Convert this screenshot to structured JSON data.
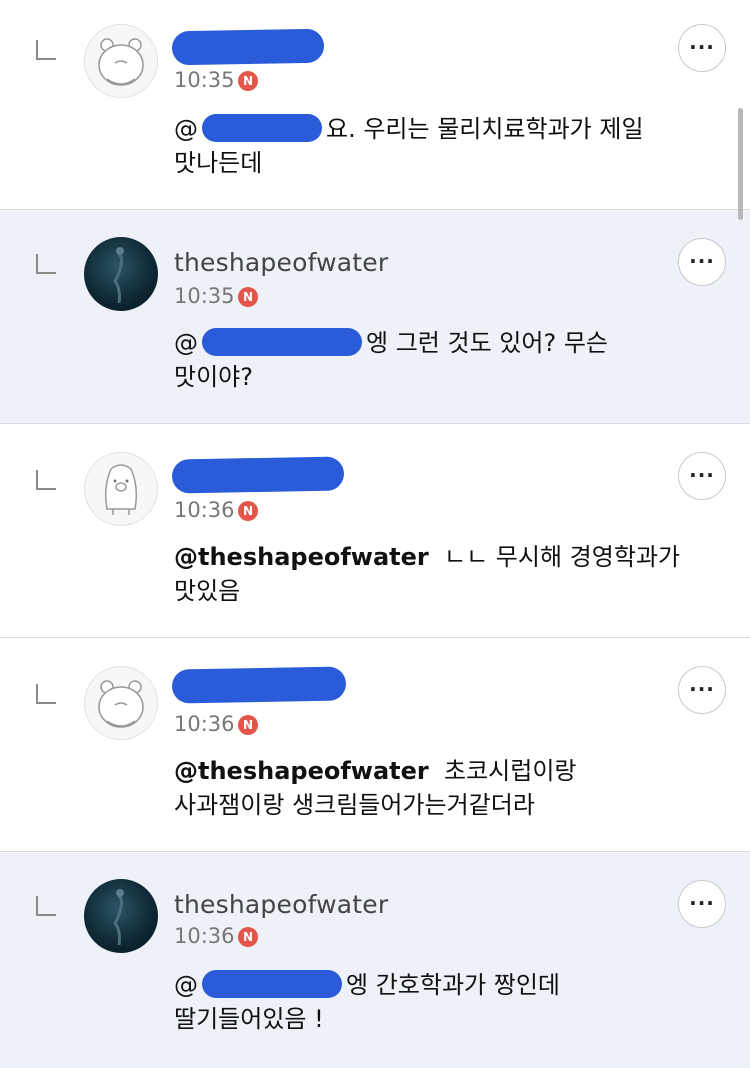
{
  "comments": [
    {
      "nickname": "",
      "nickname_redacted": true,
      "time": "10:35",
      "badge": "N",
      "avatar": "bear-character-icon",
      "text_prefix": "@",
      "text_after_redaction": "요. 우리는 물리치료학과가 제일 맛나든데",
      "mention": "",
      "more_label": "···"
    },
    {
      "nickname": "theshapeofwater",
      "nickname_redacted": false,
      "time": "10:35",
      "badge": "N",
      "avatar": "underwater-photo",
      "text_prefix": "@",
      "text_after_redaction": "엥 그런 것도 있어? 무슨 맛이야?",
      "mention": "",
      "more_label": "···"
    },
    {
      "nickname": "",
      "nickname_redacted": true,
      "time": "10:36",
      "badge": "N",
      "avatar": "penguin-character-icon",
      "mention": "@theshapeofwater",
      "text": "ㄴㄴ 무시해 경영학과가 맛있음",
      "more_label": "···"
    },
    {
      "nickname": "",
      "nickname_redacted": true,
      "time": "10:36",
      "badge": "N",
      "avatar": "bear-character-icon",
      "mention": "@theshapeofwater",
      "text": "초코시럽이랑 사과잼이랑 생크림들어가는거같더라",
      "more_label": "···"
    },
    {
      "nickname": "theshapeofwater",
      "nickname_redacted": false,
      "time": "10:36",
      "badge": "N",
      "avatar": "underwater-photo",
      "text_prefix": "@",
      "text_after_redaction": "엥 간호학과가 짱인데 딸기들어있음 !",
      "mention": "",
      "more_label": "···"
    }
  ],
  "colors": {
    "highlight_bg": "#eef1f8",
    "badge": "#e4564a",
    "redaction": "#2a5bd8"
  }
}
